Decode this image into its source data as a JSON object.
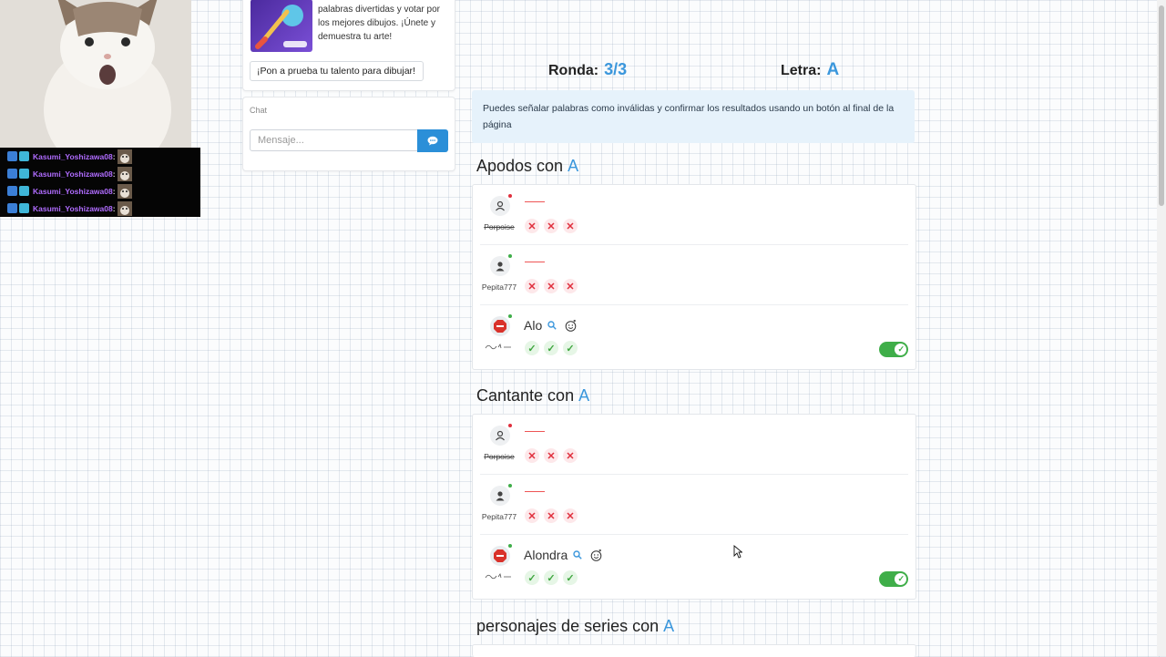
{
  "overlay": {
    "chat_lines": [
      {
        "name": "Kasumi_Yoshizawa08",
        "colon": ":"
      },
      {
        "name": "Kasumi_Yoshizawa08",
        "colon": ":"
      },
      {
        "name": "Kasumi_Yoshizawa08",
        "colon": ":"
      },
      {
        "name": "Kasumi_Yoshizawa08",
        "colon": ":"
      }
    ]
  },
  "promo": {
    "text": "palabras divertidas y votar por los mejores dibujos. ¡Únete y demuestra tu arte!",
    "button_label": "¡Pon a prueba tu talento para dibujar!"
  },
  "chat": {
    "label": "Chat",
    "placeholder": "Mensaje..."
  },
  "game": {
    "round_label": "Ronda:",
    "round_value": "3/3",
    "letter_label": "Letra:",
    "letter_value": "A",
    "info": "Puedes señalar palabras como inválidas y confirmar los resultados usando un botón al final de la página"
  },
  "categories": [
    {
      "title": "Apodos con",
      "letter": "A",
      "players": [
        {
          "name": "Porpoise",
          "answer": "",
          "status": "offline",
          "votes": [
            "no",
            "no",
            "no"
          ],
          "toggle": false
        },
        {
          "name": "Pepita777",
          "answer": "",
          "status": "online",
          "votes": [
            "no",
            "no",
            "no"
          ],
          "toggle": false
        },
        {
          "name": "",
          "answer": "Alo",
          "status": "online",
          "votes": [
            "yes",
            "yes",
            "yes"
          ],
          "toggle": true
        }
      ]
    },
    {
      "title": "Cantante con",
      "letter": "A",
      "players": [
        {
          "name": "Porpoise",
          "answer": "",
          "status": "offline",
          "votes": [
            "no",
            "no",
            "no"
          ],
          "toggle": false
        },
        {
          "name": "Pepita777",
          "answer": "",
          "status": "online",
          "votes": [
            "no",
            "no",
            "no"
          ],
          "toggle": false
        },
        {
          "name": "",
          "answer": "Alondra",
          "status": "online",
          "votes": [
            "yes",
            "yes",
            "yes"
          ],
          "toggle": true
        }
      ]
    },
    {
      "title": "personajes de series con",
      "letter": "A",
      "players": []
    }
  ],
  "colors": {
    "accent": "#3b97dc",
    "toggle_on": "#3fae49",
    "vote_no": "#e0303e",
    "vote_yes": "#3fa63f",
    "offline_dot": "#e0303e",
    "online_dot": "#3fae49"
  }
}
